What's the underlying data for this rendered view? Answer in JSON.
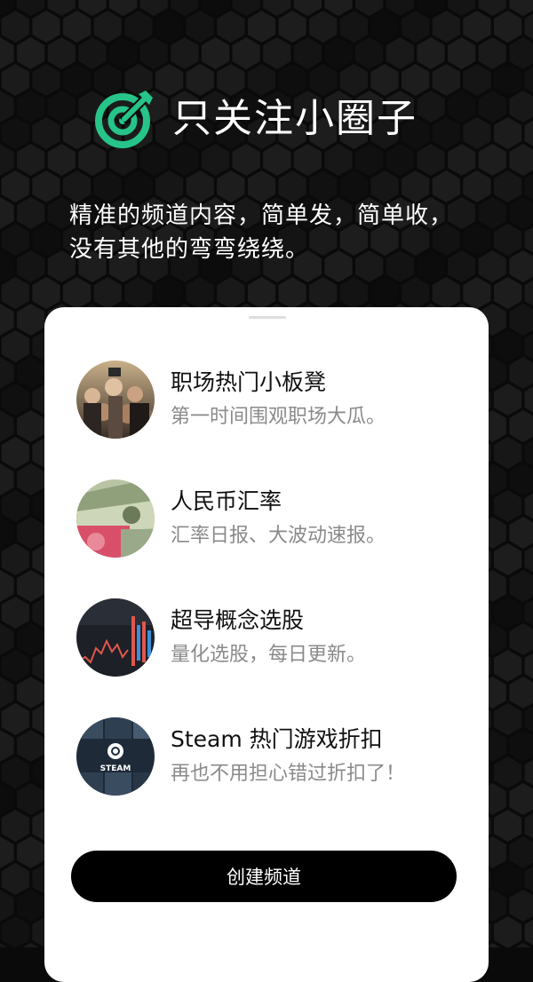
{
  "app": {
    "title": "只关注小圈子",
    "tagline_lines": [
      "精准的频道内容，简单发，简单收，",
      "没有其他的弯弯绕绕。"
    ],
    "accent_color": "#27c489",
    "logo_icon": "target-arrow-icon"
  },
  "channels": [
    {
      "name": "职场热门小板凳",
      "desc": "第一时间围观职场大瓜。",
      "icon": "crowd-photo"
    },
    {
      "name": "人民币汇率",
      "desc": "汇率日报、大波动速报。",
      "icon": "currency-notes-photo"
    },
    {
      "name": "超导概念选股",
      "desc": "量化选股，每日更新。",
      "icon": "stock-chart-photo"
    },
    {
      "name": "Steam 热门游戏折扣",
      "desc": "再也不用担心错过折扣了！",
      "icon": "steam-logo",
      "avatar_label": "STEAM"
    }
  ],
  "actions": {
    "create_label": "创建频道"
  }
}
